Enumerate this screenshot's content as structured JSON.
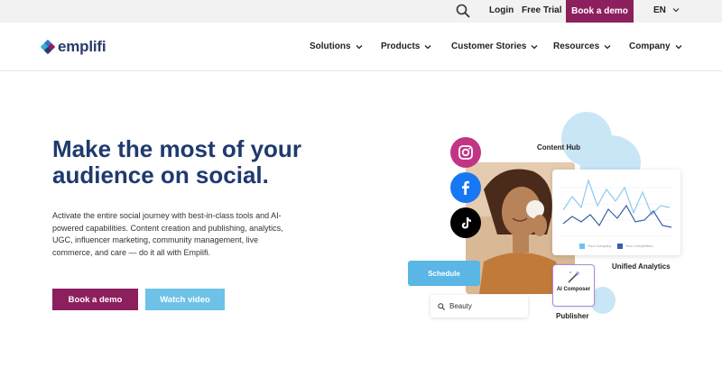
{
  "topbar": {
    "login": "Login",
    "free_trial": "Free Trial",
    "book_demo": "Book a demo",
    "language": "EN"
  },
  "brand": {
    "name": "emplifi"
  },
  "nav": {
    "items": [
      {
        "label": "Solutions"
      },
      {
        "label": "Products"
      },
      {
        "label": "Customer Stories"
      },
      {
        "label": "Resources"
      },
      {
        "label": "Company"
      }
    ]
  },
  "hero": {
    "title": "Make the most of your audience on social.",
    "description": "Activate the entire social journey with best-in-class tools and AI-powered capabilities. Content creation and publishing, analytics, UGC, influencer marketing, community management, live commerce, and care — do it all with Emplifi.",
    "book_demo": "Book a demo",
    "watch_video": "Watch video"
  },
  "illustration": {
    "content_hub": "Content Hub",
    "unified_analytics": "Unified Analytics",
    "publisher": "Publisher",
    "schedule": "Schedule",
    "search_value": "Beauty",
    "ai_composer": "AI Composer",
    "legend_your_company": "Your Company",
    "legend_competition": "Your Competition",
    "social_icons": [
      "instagram-icon",
      "facebook-icon",
      "tiktok-icon"
    ]
  },
  "colors": {
    "brand_magenta": "#8c1f5e",
    "accent_blue": "#6ec2e8",
    "title_navy": "#1f3a6e"
  }
}
